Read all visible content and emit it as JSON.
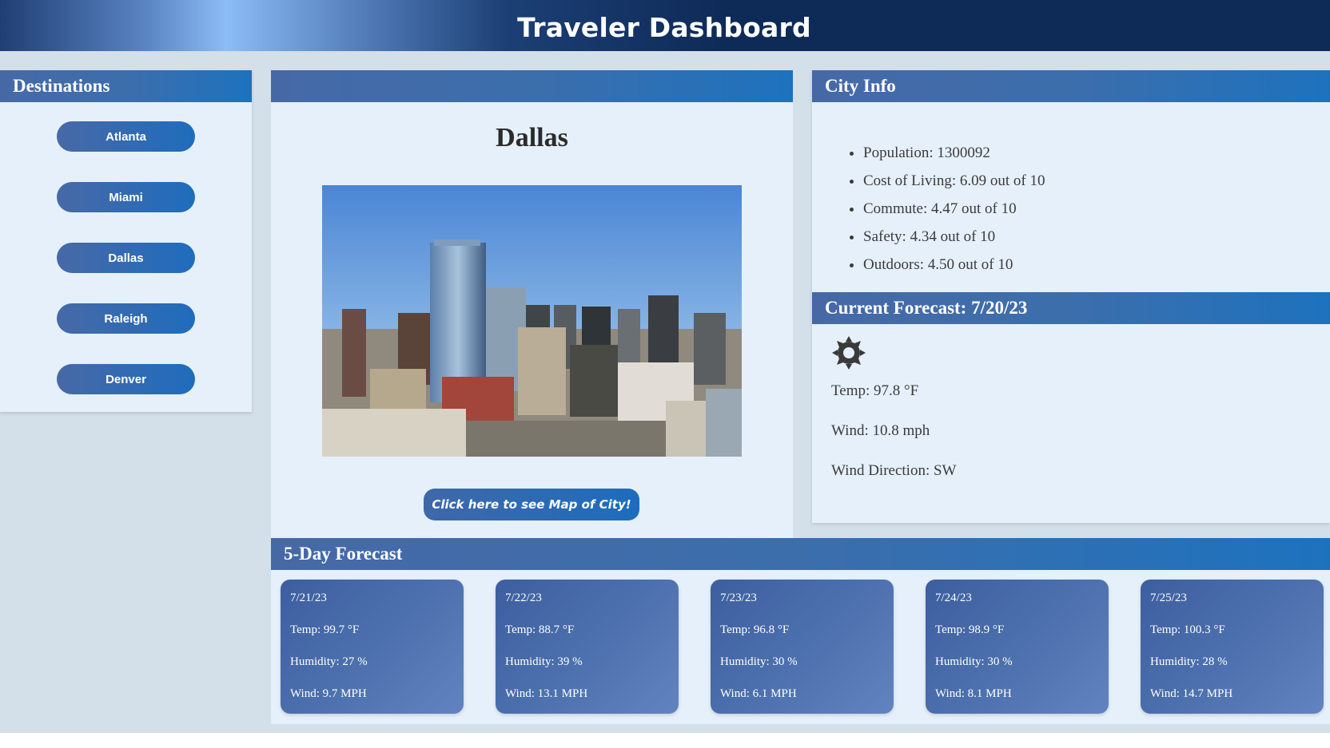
{
  "header": {
    "title": "Traveler Dashboard"
  },
  "destinations": {
    "title": "Destinations",
    "cities": [
      "Atlanta",
      "Miami",
      "Dallas",
      "Raleigh",
      "Denver"
    ]
  },
  "main": {
    "city_name": "Dallas",
    "map_button": "Click here to see Map of City!"
  },
  "city_info": {
    "title": "City Info",
    "stats": [
      "Population: 1300092",
      "Cost of Living: 6.09 out of 10",
      "Commute: 4.47 out of 10",
      "Safety: 4.34 out of 10",
      "Outdoors: 4.50 out of 10"
    ]
  },
  "current_forecast": {
    "title": "Current Forecast: 7/20/23",
    "icon": "sun-icon",
    "temp": "Temp: 97.8 °F",
    "wind": "Wind: 10.8 mph",
    "wind_direction": "Wind Direction: SW"
  },
  "five_day": {
    "title": "5-Day Forecast",
    "days": [
      {
        "date": "7/21/23",
        "temp": "Temp: 99.7 °F",
        "humidity": "Humidity: 27 %",
        "wind": "Wind: 9.7 MPH"
      },
      {
        "date": "7/22/23",
        "temp": "Temp: 88.7 °F",
        "humidity": "Humidity: 39 %",
        "wind": "Wind: 13.1 MPH"
      },
      {
        "date": "7/23/23",
        "temp": "Temp: 96.8 °F",
        "humidity": "Humidity: 30 %",
        "wind": "Wind: 6.1 MPH"
      },
      {
        "date": "7/24/23",
        "temp": "Temp: 98.9 °F",
        "humidity": "Humidity: 30 %",
        "wind": "Wind: 8.1 MPH"
      },
      {
        "date": "7/25/23",
        "temp": "Temp: 100.3 °F",
        "humidity": "Humidity: 28 %",
        "wind": "Wind: 14.7 MPH"
      }
    ]
  },
  "colors": {
    "header_dark": "#0e2a57",
    "panel_head": "#1d72be",
    "panel_bg": "#e6f0fb",
    "page_bg": "#d3dfe9"
  }
}
